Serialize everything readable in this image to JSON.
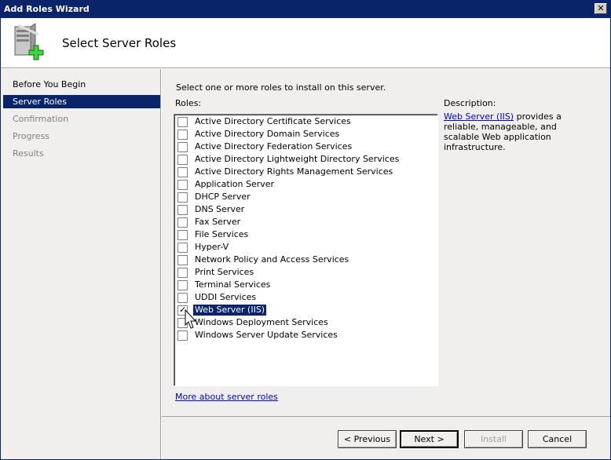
{
  "window": {
    "title": "Add Roles Wizard",
    "close_label": "✕"
  },
  "header": {
    "title": "Select Server Roles",
    "icon": "server-add-icon"
  },
  "sidebar": {
    "steps": [
      {
        "label": "Before You Begin",
        "state": "normal"
      },
      {
        "label": "Server Roles",
        "state": "active"
      },
      {
        "label": "Confirmation",
        "state": "dim"
      },
      {
        "label": "Progress",
        "state": "dim"
      },
      {
        "label": "Results",
        "state": "dim"
      }
    ]
  },
  "main": {
    "instruction": "Select one or more roles to install on this server.",
    "roles_label": "Roles:",
    "roles": [
      {
        "label": "Active Directory Certificate Services",
        "checked": false
      },
      {
        "label": "Active Directory Domain Services",
        "checked": false
      },
      {
        "label": "Active Directory Federation Services",
        "checked": false
      },
      {
        "label": "Active Directory Lightweight Directory Services",
        "checked": false
      },
      {
        "label": "Active Directory Rights Management Services",
        "checked": false
      },
      {
        "label": "Application Server",
        "checked": false
      },
      {
        "label": "DHCP Server",
        "checked": false
      },
      {
        "label": "DNS Server",
        "checked": false
      },
      {
        "label": "Fax Server",
        "checked": false
      },
      {
        "label": "File Services",
        "checked": false
      },
      {
        "label": "Hyper-V",
        "checked": false
      },
      {
        "label": "Network Policy and Access Services",
        "checked": false
      },
      {
        "label": "Print Services",
        "checked": false
      },
      {
        "label": "Terminal Services",
        "checked": false
      },
      {
        "label": "UDDI Services",
        "checked": false
      },
      {
        "label": "Web Server (IIS)",
        "checked": true,
        "selected": true
      },
      {
        "label": "Windows Deployment Services",
        "checked": false
      },
      {
        "label": "Windows Server Update Services",
        "checked": false
      }
    ],
    "description_label": "Description:",
    "description_link": "Web Server (IIS)",
    "description_text": " provides a reliable, manageable, and scalable Web application infrastructure.",
    "more_link": "More about server roles"
  },
  "footer": {
    "previous": "< Previous",
    "next": "Next >",
    "install": "Install",
    "cancel": "Cancel"
  },
  "colors": {
    "selection": "#0a246a",
    "link": "#0000cc",
    "panel": "#f0efed"
  }
}
